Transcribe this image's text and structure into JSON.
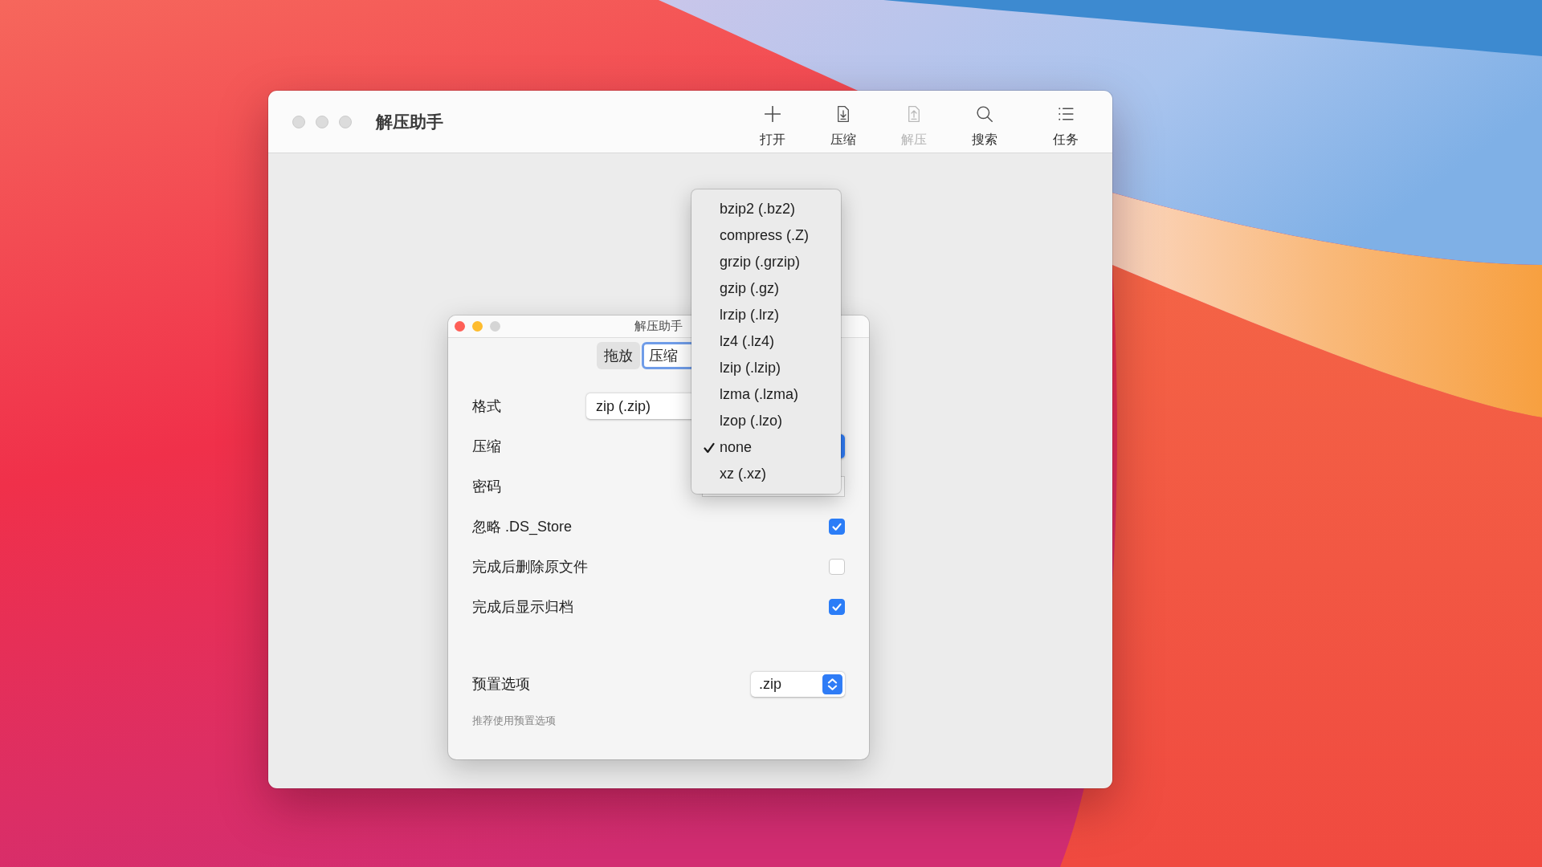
{
  "main_window": {
    "title": "解压助手",
    "toolbar": [
      {
        "label": "打开",
        "disabled": false
      },
      {
        "label": "压缩",
        "disabled": false
      },
      {
        "label": "解压",
        "disabled": true
      },
      {
        "label": "搜索",
        "disabled": false
      },
      {
        "label": "任务",
        "disabled": false
      }
    ]
  },
  "dialog": {
    "title": "解压助手",
    "tabs": [
      {
        "label": "拖放",
        "selected": false
      },
      {
        "label": "压缩",
        "selected": true
      }
    ],
    "settings": [
      {
        "kind": "popup",
        "label": "格式",
        "value": "zip (.zip)"
      },
      {
        "kind": "popup",
        "label": "压缩"
      },
      {
        "kind": "field",
        "label": "密码"
      },
      {
        "kind": "checkbox",
        "label": "忽略 .DS_Store",
        "checked": true
      },
      {
        "kind": "checkbox",
        "label": "完成后删除原文件",
        "checked": false
      },
      {
        "kind": "checkbox",
        "label": "完成后显示归档",
        "checked": true
      }
    ],
    "preset": {
      "label": "预置选项",
      "value": ".zip",
      "hint": "推荐使用预置选项"
    }
  },
  "menu": {
    "items": [
      {
        "label": "bzip2 (.bz2)",
        "selected": false
      },
      {
        "label": "compress (.Z)",
        "selected": false
      },
      {
        "label": "grzip (.grzip)",
        "selected": false
      },
      {
        "label": "gzip (.gz)",
        "selected": false
      },
      {
        "label": "lrzip (.lrz)",
        "selected": false
      },
      {
        "label": "lz4 (.lz4)",
        "selected": false
      },
      {
        "label": "lzip (.lzip)",
        "selected": false
      },
      {
        "label": "lzma (.lzma)",
        "selected": false
      },
      {
        "label": "lzop (.lzo)",
        "selected": false
      },
      {
        "label": "none",
        "selected": true
      },
      {
        "label": "xz (.xz)",
        "selected": false
      }
    ]
  }
}
